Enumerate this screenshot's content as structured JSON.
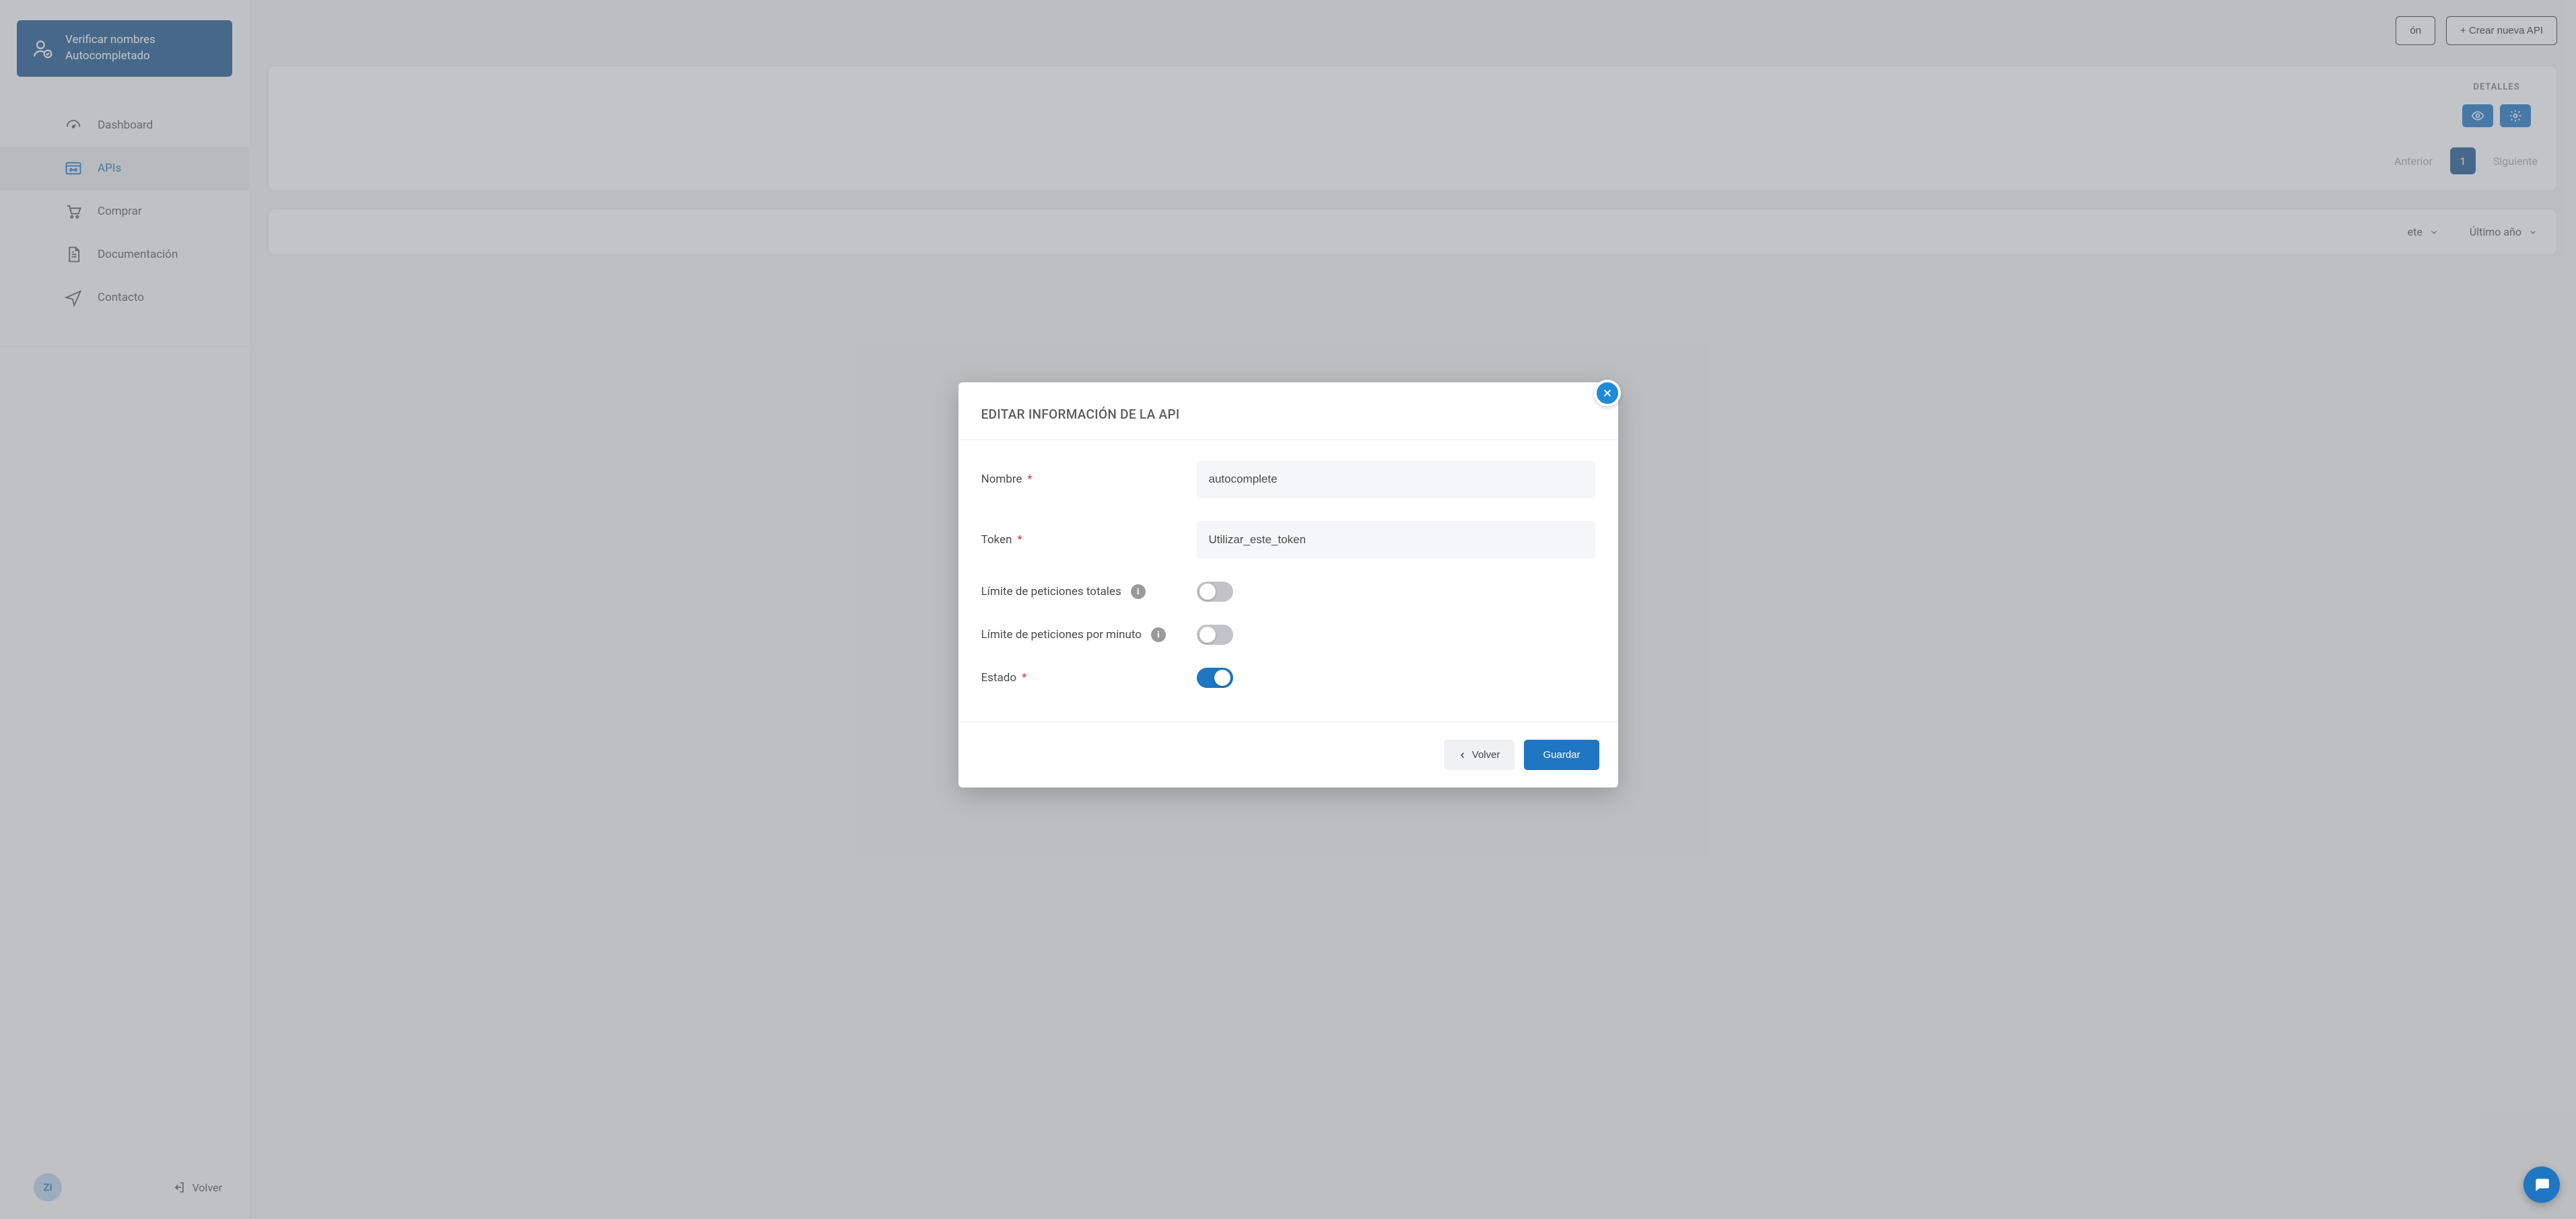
{
  "sidebar": {
    "verify": {
      "line1": "Verificar nombres",
      "line2": "Autocompletado"
    },
    "items": [
      {
        "label": "Dashboard"
      },
      {
        "label": "APIs"
      },
      {
        "label": "Comprar"
      },
      {
        "label": "Documentación"
      },
      {
        "label": "Contacto"
      }
    ],
    "avatar": "ZI",
    "back": "Volver"
  },
  "main": {
    "actions": {
      "left_suffix": "ón",
      "create": "+ Crear nueva API"
    },
    "details_header": "DETALLES",
    "pager": {
      "prev": "Anterior",
      "page": "1",
      "next": "Siguiente"
    },
    "filters": {
      "left_suffix": "ete",
      "period": "Último año"
    }
  },
  "modal": {
    "title": "EDITAR INFORMACIÓN DE LA API",
    "fields": {
      "name_label": "Nombre",
      "name_value": "autocomplete",
      "token_label": "Token",
      "token_value": "Utilizar_este_token",
      "limit_total_label": "Límite de peticiones totales",
      "limit_minute_label": "Límite de peticiones por minuto",
      "status_label": "Estado"
    },
    "buttons": {
      "back": "Volver",
      "save": "Guardar"
    }
  }
}
